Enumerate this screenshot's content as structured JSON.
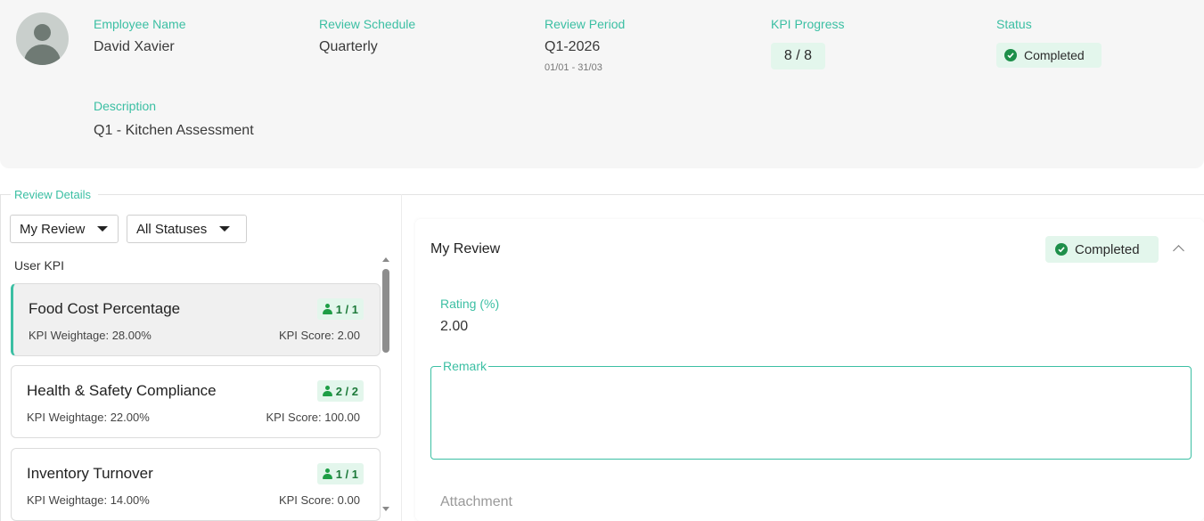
{
  "header": {
    "employee_name_label": "Employee Name",
    "employee_name": "David Xavier",
    "review_schedule_label": "Review Schedule",
    "review_schedule": "Quarterly",
    "review_period_label": "Review Period",
    "review_period": "Q1-2026",
    "review_period_range": "01/01 - 31/03",
    "kpi_progress_label": "KPI Progress",
    "kpi_progress": "8 / 8",
    "status_label": "Status",
    "status": "Completed",
    "description_label": "Description",
    "description": "Q1 - Kitchen Assessment"
  },
  "review_details": {
    "legend": "Review Details",
    "filter_review": "My Review",
    "filter_status": "All Statuses",
    "list_heading": "User KPI",
    "kpis": [
      {
        "name": "Food Cost Percentage",
        "badge": "1 / 1",
        "weightage": "KPI Weightage: 28.00%",
        "score": "KPI Score: 2.00"
      },
      {
        "name": "Health & Safety Compliance",
        "badge": "2 / 2",
        "weightage": "KPI Weightage: 22.00%",
        "score": "KPI Score: 100.00"
      },
      {
        "name": "Inventory Turnover",
        "badge": "1 / 1",
        "weightage": "KPI Weightage: 14.00%",
        "score": "KPI Score: 0.00"
      }
    ]
  },
  "my_review": {
    "title": "My Review",
    "status": "Completed",
    "rating_label": "Rating (%)",
    "rating_value": "2.00",
    "remark_label": "Remark",
    "remark_value": "",
    "attachment_label": "Attachment"
  },
  "colors": {
    "accent": "#3bbfa3",
    "chip_bg": "#e3f6ec",
    "success": "#1e8f4a"
  }
}
